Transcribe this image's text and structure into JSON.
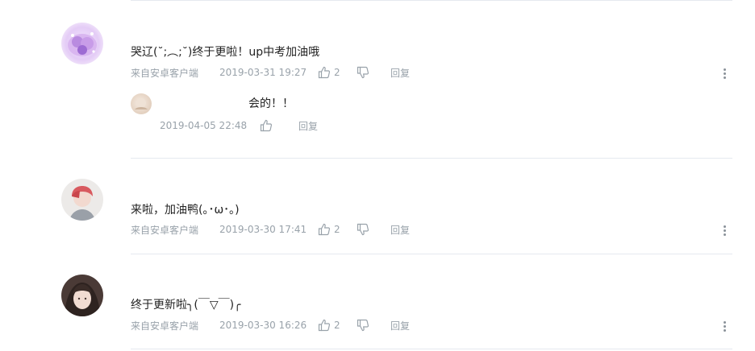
{
  "comments": [
    {
      "text": "哭辽(˘;︵;˘)终于更啦！up中考加油哦",
      "source": "来自安卓客户端",
      "time": "2019-03-31 19:27",
      "likes": "2",
      "reply_label": "回复",
      "reply": {
        "text": "会的！！",
        "time": "2019-04-05 22:48",
        "reply_label": "回复"
      }
    },
    {
      "text": "来啦，加油鸭(｡･ω･｡)",
      "source": "来自安卓客户端",
      "time": "2019-03-30 17:41",
      "likes": "2",
      "reply_label": "回复"
    },
    {
      "text": "终于更新啦╮(￣▽￣)╭",
      "source": "来自安卓客户端",
      "time": "2019-03-30 16:26",
      "likes": "2",
      "reply_label": "回复"
    }
  ],
  "icons": {
    "like": "thumbs-up-icon",
    "dislike": "thumbs-down-icon",
    "more": "more-vertical-icon"
  },
  "colors": {
    "text": "#222222",
    "meta": "#99a2aa",
    "divider": "#e5e9ef"
  }
}
